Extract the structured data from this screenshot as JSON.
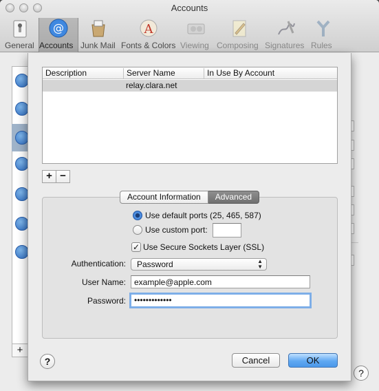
{
  "window": {
    "title": "Accounts"
  },
  "toolbar": {
    "items": [
      {
        "label": "General",
        "icon": "general-switch-icon"
      },
      {
        "label": "Accounts",
        "icon": "at-sign-icon"
      },
      {
        "label": "Junk Mail",
        "icon": "junk-mail-icon"
      },
      {
        "label": "Fonts & Colors",
        "icon": "fonts-colors-icon"
      },
      {
        "label": "Viewing",
        "icon": "viewing-icon"
      },
      {
        "label": "Composing",
        "icon": "composing-icon"
      },
      {
        "label": "Signatures",
        "icon": "signatures-icon"
      },
      {
        "label": "Rules",
        "icon": "rules-icon"
      }
    ],
    "selected": "Accounts"
  },
  "server_table": {
    "headers": [
      "Description",
      "Server Name",
      "In Use By Account"
    ],
    "rows": [
      {
        "description": "",
        "server_name": "relay.clara.net",
        "in_use_by": ""
      }
    ]
  },
  "table_buttons": {
    "add": "+",
    "remove": "−"
  },
  "tabs": [
    {
      "label": "Account Information",
      "active": false
    },
    {
      "label": "Advanced",
      "active": true
    }
  ],
  "advanced": {
    "use_default_ports": "Use default ports (25, 465, 587)",
    "use_custom_port": "Use custom port:",
    "custom_port_value": "",
    "use_ssl": "Use Secure Sockets Layer (SSL)",
    "ssl_checked": true,
    "authentication_label": "Authentication:",
    "authentication_value": "Password",
    "user_name_label": "User Name:",
    "user_name_value": "example@apple.com",
    "password_label": "Password:",
    "password_value": "•••••••••••••"
  },
  "buttons": {
    "help": "?",
    "cancel": "Cancel",
    "ok": "OK"
  },
  "colors": {
    "accent": "#4b98ea",
    "selection": "#d5d5d5"
  }
}
